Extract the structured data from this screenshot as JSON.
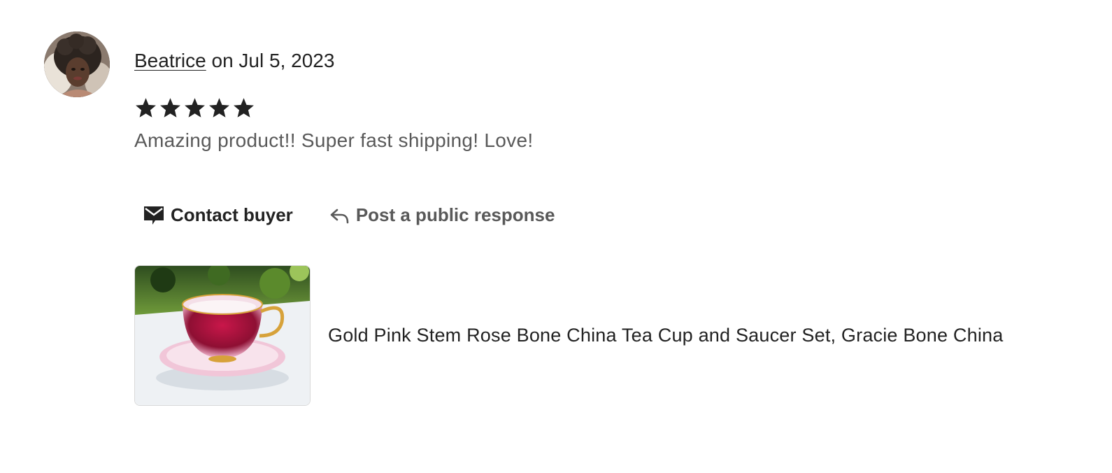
{
  "review": {
    "reviewer_name": "Beatrice",
    "date_text": "on Jul 5, 2023",
    "rating": 5,
    "rating_max": 5,
    "text": "Amazing product!! Super fast shipping! Love!"
  },
  "actions": {
    "contact_label": "Contact buyer",
    "contact_icon": "envelope-icon",
    "respond_label": "Post a public response",
    "respond_icon": "reply-arrow-icon"
  },
  "product": {
    "title": "Gold Pink Stem Rose Bone China Tea Cup and Saucer Set, Gracie Bone China"
  },
  "colors": {
    "primary_text": "#222222",
    "secondary_text": "#595959",
    "star": "#222222"
  }
}
